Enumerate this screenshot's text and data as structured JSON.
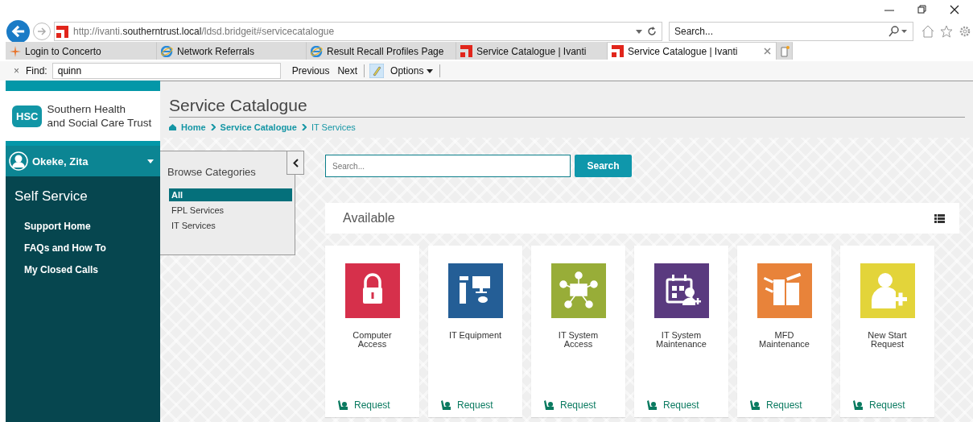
{
  "browser": {
    "address": "http://ivanti.**southerntrust.local**/ldsd.bridgeit#servicecatalogue",
    "search_placeholder": "Search...",
    "tabs": [
      {
        "label": "Login to Concerto",
        "kind": "star",
        "selected": false
      },
      {
        "label": "Network Referrals",
        "kind": "globe",
        "selected": false
      },
      {
        "label": "Result Recall Profiles Page",
        "kind": "globe",
        "selected": false
      },
      {
        "label": "Service Catalogue | Ivanti",
        "kind": "logo",
        "selected": false
      },
      {
        "label": "Service Catalogue | Ivanti",
        "kind": "logo",
        "selected": true
      }
    ],
    "find_bar": {
      "close": "×",
      "label": "Find:",
      "value": "quinn",
      "buttons": [
        "Previous",
        "Next"
      ],
      "options": "Options"
    }
  },
  "sidebar": {
    "org_name": [
      "Southern Health",
      "and Social Care Trust"
    ],
    "logo_text": "HSC",
    "user": "Okeke, Zita",
    "section": "Self Service",
    "items": [
      "Support Home",
      "FAQs and How To",
      "My Closed Calls"
    ]
  },
  "header": {
    "title": "Service Catalogue",
    "breadcrumb": [
      "Home",
      "Service Catalogue",
      "IT Services"
    ]
  },
  "browse": {
    "title": "Browse Categories",
    "categories": [
      {
        "label": "All",
        "selected": true
      },
      {
        "label": "FPL Services",
        "selected": false
      },
      {
        "label": "IT Services",
        "selected": false
      }
    ]
  },
  "search": {
    "placeholder": "Search...",
    "button": "Search"
  },
  "available": {
    "title": "Available"
  },
  "services": [
    {
      "name": "Computer Access",
      "kind": "lock",
      "color": "#d6304b",
      "action": "Request"
    },
    {
      "name": "IT Equipment",
      "kind": "computer",
      "color": "#245e96",
      "action": "Request"
    },
    {
      "name": "IT System Access",
      "kind": "network",
      "color": "#98ad38",
      "action": "Request"
    },
    {
      "name": "IT System Maintenance",
      "kind": "calendar",
      "color": "#5a3a7f",
      "action": "Request"
    },
    {
      "name": "MFD Maintenance",
      "kind": "printer",
      "color": "#e8833a",
      "action": "Request"
    },
    {
      "name": "New Start Request",
      "kind": "person",
      "color": "#e3d43a",
      "action": "Request"
    }
  ]
}
